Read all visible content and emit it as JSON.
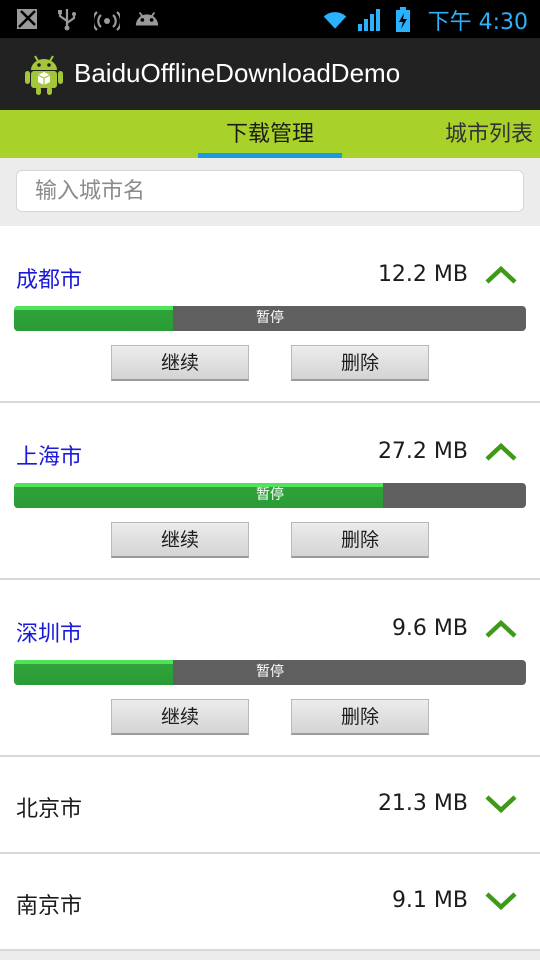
{
  "status_bar": {
    "time": "下午 4:30",
    "icons": [
      "no-sim-icon",
      "usb-icon",
      "wifi-hotspot-icon",
      "android-debug-icon",
      "wifi-icon",
      "signal-icon",
      "battery-charging-icon"
    ]
  },
  "app": {
    "title": "BaiduOfflineDownloadDemo",
    "icon": "android-app-icon"
  },
  "tabs": [
    {
      "label": "下载管理",
      "active": true
    },
    {
      "label": "城市列表",
      "active": false
    }
  ],
  "search": {
    "placeholder": "输入城市名",
    "value": ""
  },
  "colors": {
    "tab_bar": "#a8d22a",
    "tab_indicator": "#1a9be0",
    "city_active": "#1a1adb",
    "progress_fill": "#2a9b36",
    "chevron": "#3f9a1a"
  },
  "downloads": [
    {
      "city": "成都市",
      "size": "12.2 MB",
      "expanded": true,
      "progress": 0.31,
      "status": "暂停",
      "btn_continue": "继续",
      "btn_delete": "删除"
    },
    {
      "city": "上海市",
      "size": "27.2 MB",
      "expanded": true,
      "progress": 0.72,
      "status": "暂停",
      "btn_continue": "继续",
      "btn_delete": "删除"
    },
    {
      "city": "深圳市",
      "size": "9.6 MB",
      "expanded": true,
      "progress": 0.31,
      "status": "暂停",
      "btn_continue": "继续",
      "btn_delete": "删除"
    },
    {
      "city": "北京市",
      "size": "21.3 MB",
      "expanded": false
    },
    {
      "city": "南京市",
      "size": "9.1 MB",
      "expanded": false
    }
  ]
}
